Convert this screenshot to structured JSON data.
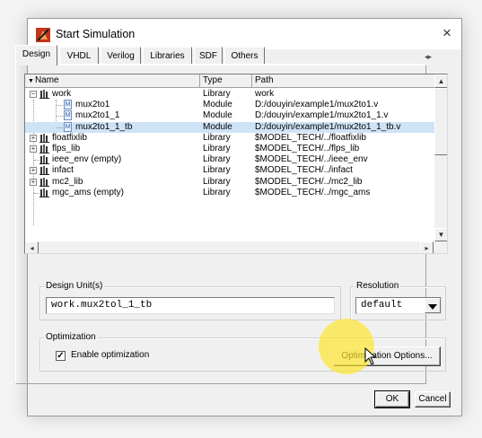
{
  "window": {
    "title": "Start Simulation",
    "close_glyph": "×"
  },
  "tabs": [
    "Design",
    "VHDL",
    "Verilog",
    "Libraries",
    "SDF",
    "Others"
  ],
  "tab_scroll_glyph": "◂▸",
  "table": {
    "headers": [
      "Name",
      "Type",
      "Path"
    ],
    "rows": [
      {
        "name": "work",
        "type": "Library",
        "path": "work"
      },
      {
        "name": "mux2to1",
        "type": "Module",
        "path": "D:/douyin/example1/mux2to1.v"
      },
      {
        "name": "mux2to1_1",
        "type": "Module",
        "path": "D:/douyin/example1/mux2to1_1.v"
      },
      {
        "name": "mux2to1_1_tb",
        "type": "Module",
        "path": "D:/douyin/example1/mux2to1_1_tb.v"
      },
      {
        "name": "floatfixlib",
        "type": "Library",
        "path": "$MODEL_TECH/../floatfixlib"
      },
      {
        "name": "flps_lib",
        "type": "Library",
        "path": "$MODEL_TECH/../flps_lib"
      },
      {
        "name": "ieee_env  (empty)",
        "type": "Library",
        "path": "$MODEL_TECH/../ieee_env"
      },
      {
        "name": "infact",
        "type": "Library",
        "path": "$MODEL_TECH/../infact"
      },
      {
        "name": "mc2_lib",
        "type": "Library",
        "path": "$MODEL_TECH/../mc2_lib"
      },
      {
        "name": "mgc_ams  (empty)",
        "type": "Library",
        "path": "$MODEL_TECH/../mgc_ams"
      }
    ]
  },
  "design_unit": {
    "label": "Design Unit(s)",
    "value": "work.mux2tol_1_tb"
  },
  "resolution": {
    "label": "Resolution",
    "value": "default"
  },
  "optimization": {
    "label": "Optimization",
    "checkbox_label": "Enable optimization",
    "checked": true,
    "options_button": "Optimization Options..."
  },
  "buttons": {
    "ok": "OK",
    "cancel": "Cancel"
  },
  "colors": {
    "selection": "#cfe3f7",
    "highlight": "#ffe628"
  }
}
